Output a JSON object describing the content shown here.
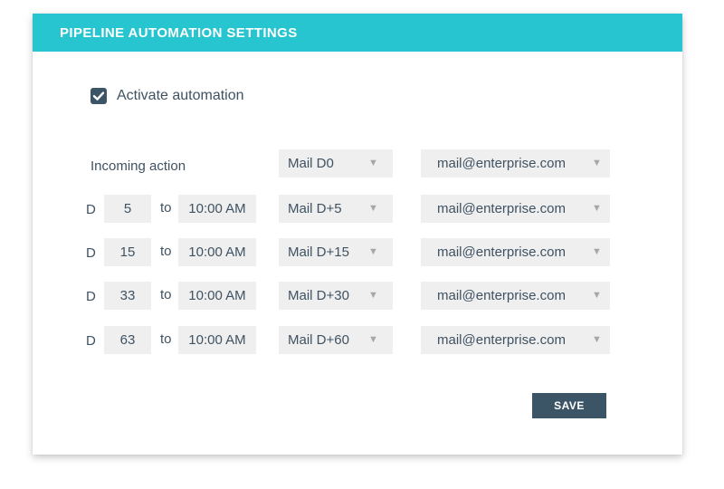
{
  "header": {
    "title": "PIPELINE AUTOMATION SETTINGS",
    "accent_color": "#26c5d0"
  },
  "activate": {
    "label": "Activate automation",
    "checked": true,
    "icon": "checkmark-icon"
  },
  "incoming": {
    "label": "Incoming action",
    "mail_template": "Mail D0",
    "email": "mail@enterprise.com"
  },
  "rows": [
    {
      "d_label": "D",
      "day": "5",
      "to_label": "to",
      "time": "10:00 AM",
      "mail_template": "Mail D+5",
      "email": "mail@enterprise.com"
    },
    {
      "d_label": "D",
      "day": "15",
      "to_label": "to",
      "time": "10:00 AM",
      "mail_template": "Mail D+15",
      "email": "mail@enterprise.com"
    },
    {
      "d_label": "D",
      "day": "33",
      "to_label": "to",
      "time": "10:00 AM",
      "mail_template": "Mail D+30",
      "email": "mail@enterprise.com"
    },
    {
      "d_label": "D",
      "day": "63",
      "to_label": "to",
      "time": "10:00 AM",
      "mail_template": "Mail D+60",
      "email": "mail@enterprise.com"
    }
  ],
  "caret_glyph": "▼",
  "save": {
    "label": "SAVE",
    "color": "#3c5566"
  }
}
